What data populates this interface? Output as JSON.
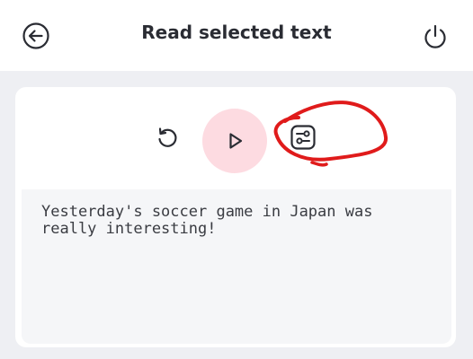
{
  "header": {
    "title": "Read selected text",
    "back_icon": "back-arrow-icon",
    "power_icon": "power-icon"
  },
  "controls": {
    "reset_icon": "reset-icon",
    "play_icon": "play-icon",
    "settings_icon": "sliders-settings-icon",
    "play_background": "#fddbe1",
    "annotation_color": "#e01b1b"
  },
  "content": {
    "text": "Yesterday's soccer game in Japan was really interesting!"
  }
}
